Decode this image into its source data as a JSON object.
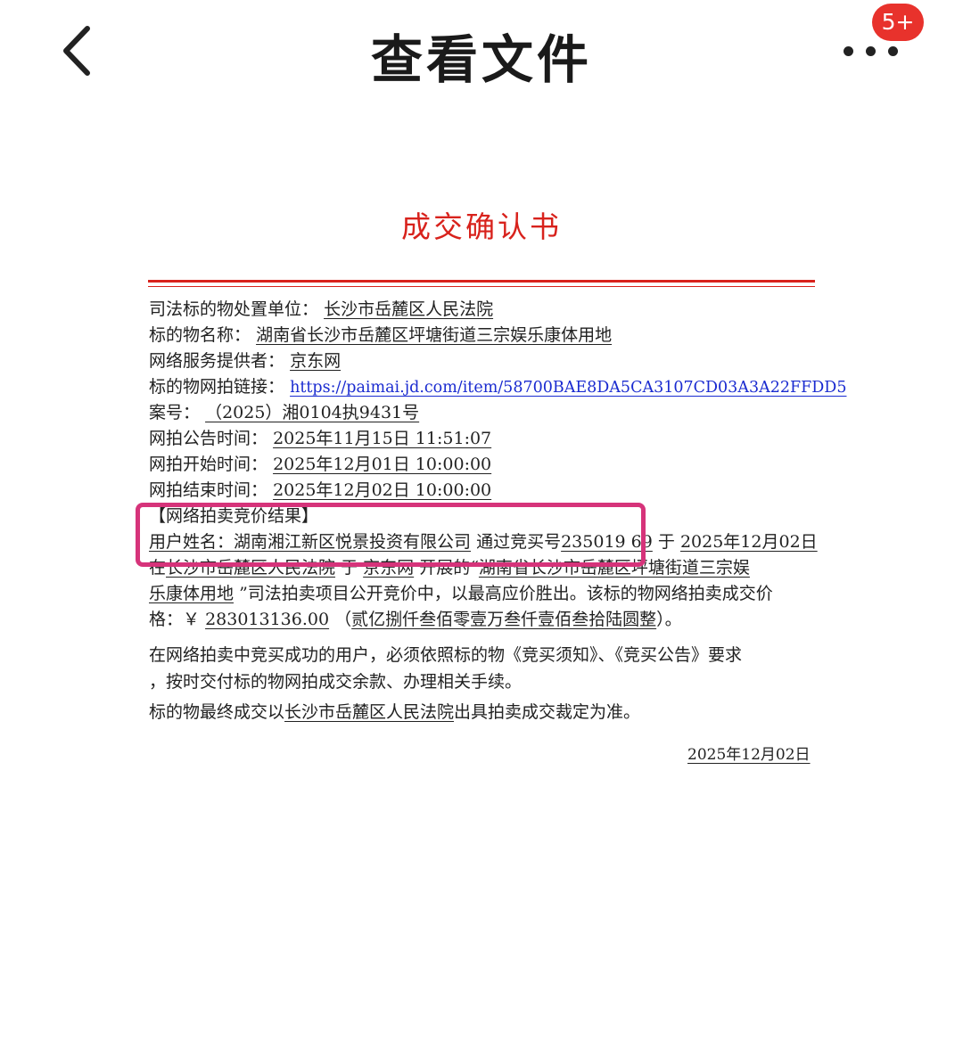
{
  "topbar": {
    "title": "查看文件",
    "badge": "5+",
    "back_icon": "chevron-left-icon",
    "more_icon": "more-horizontal-icon"
  },
  "document": {
    "title": "成交确认书",
    "accent_color": "#d8221c",
    "fields": [
      {
        "label": "司法标的物处置单位：",
        "value": "长沙市岳麓区人民法院"
      },
      {
        "label": "标的物名称：",
        "value": "湖南省长沙市岳麓区坪塘街道三宗娱乐康体用地"
      },
      {
        "label": "网络服务提供者：",
        "value": "京东网"
      },
      {
        "label": "标的物网拍链接：",
        "value": "https://paimai.jd.com/item/58700BAE8DA5CA3107CD03A3A22FFDD5"
      },
      {
        "label": "案号：",
        "value": "（2025）湘0104执9431号"
      },
      {
        "label": "网拍公告时间：",
        "value": "2025年11月15日 11:51:07"
      },
      {
        "label": "网拍开始时间：",
        "value": "2025年12月01日 10:00:00"
      },
      {
        "label": "网拍结束时间：",
        "value": "2025年12月02日 10:00:00"
      }
    ],
    "result": {
      "heading": "【网络拍卖竞价结果】",
      "user_label": "用户姓名：",
      "user_name": "湖南湘江新区悦景投资有限公司",
      "via_text": "通过竞买号",
      "bid_number": "235019 69",
      "on_text": "于",
      "date": "2025年12月02日",
      "line2_a": "在",
      "court": "长沙市岳麓区人民法院",
      "line2_b": "于",
      "platform": "京东网",
      "line2_c": "开展的“",
      "item_part1": "湖南省长沙市岳麓区坪塘街道三宗娱",
      "item_part2": "乐康体用地",
      "line3_rest": "”司法拍卖项目公开竞价中，以最高应价胜出。该标的物网络拍卖成交价",
      "price_label": "格：￥",
      "price": "283013136.00",
      "price_paren_open": "（",
      "price_words": "贰亿捌仟叁佰零壹万叁仟壹佰叁拾陆圆整",
      "price_paren_close": "）。"
    },
    "notice_line1": "在网络拍卖中竞买成功的用户，必须依照标的物《竞买须知》、《竞买公告》要求",
    "notice_line2": "，按时交付标的物网拍成交余款、办理相关手续。",
    "final_prefix": "标的物最终成交以",
    "final_court": "长沙市岳麓区人民法院",
    "final_suffix": "出具拍卖成交裁定为准。",
    "sign_date": "2025年12月02日"
  }
}
